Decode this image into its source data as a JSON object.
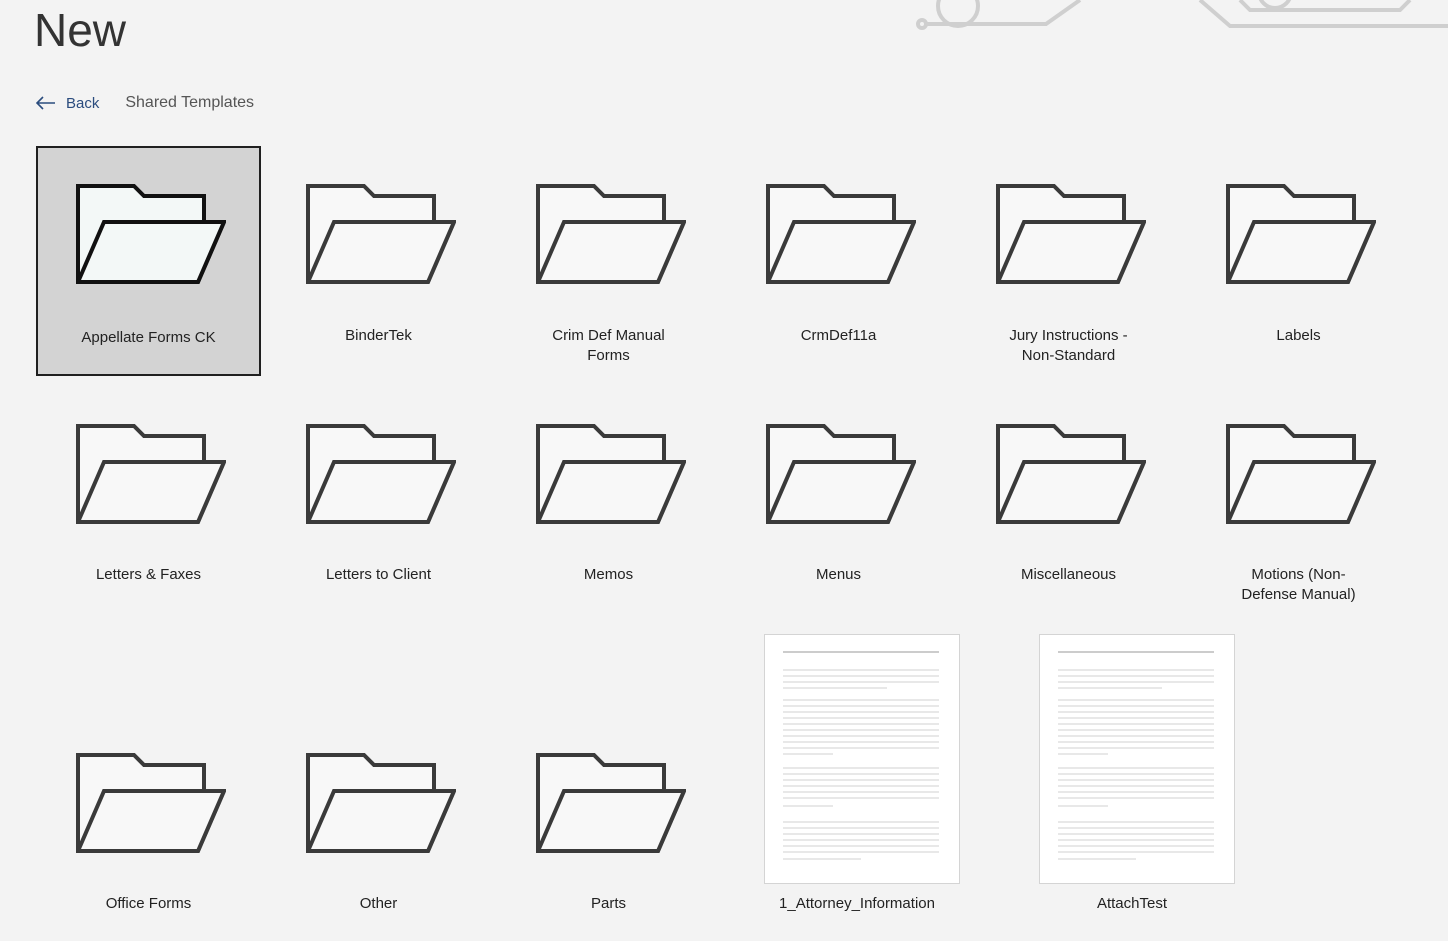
{
  "header": {
    "title": "New"
  },
  "nav": {
    "back_label": "Back",
    "breadcrumb": "Shared Templates"
  },
  "folders": [
    {
      "label": "Appellate Forms CK",
      "selected": true
    },
    {
      "label": "BinderTek"
    },
    {
      "label": "Crim Def Manual Forms"
    },
    {
      "label": "CrmDef11a"
    },
    {
      "label": "Jury Instructions - Non-Standard"
    },
    {
      "label": "Labels"
    },
    {
      "label": "Letters & Faxes"
    },
    {
      "label": "Letters to Client"
    },
    {
      "label": "Memos"
    },
    {
      "label": "Menus"
    },
    {
      "label": "Miscellaneous"
    },
    {
      "label": "Motions (Non-Defense Manual)"
    },
    {
      "label": "Office Forms"
    },
    {
      "label": "Other"
    },
    {
      "label": "Parts"
    }
  ],
  "documents": [
    {
      "label": "1_Attorney_Information"
    },
    {
      "label": "AttachTest"
    }
  ],
  "colors": {
    "background": "#f3f3f3",
    "selected_tile": "#d3d3d3",
    "folder_stroke": "#3a3a3a",
    "link": "#2b4c7e"
  },
  "icons": {
    "back": "arrow-left-icon",
    "folder": "folder-icon",
    "document": "document-thumbnail"
  }
}
